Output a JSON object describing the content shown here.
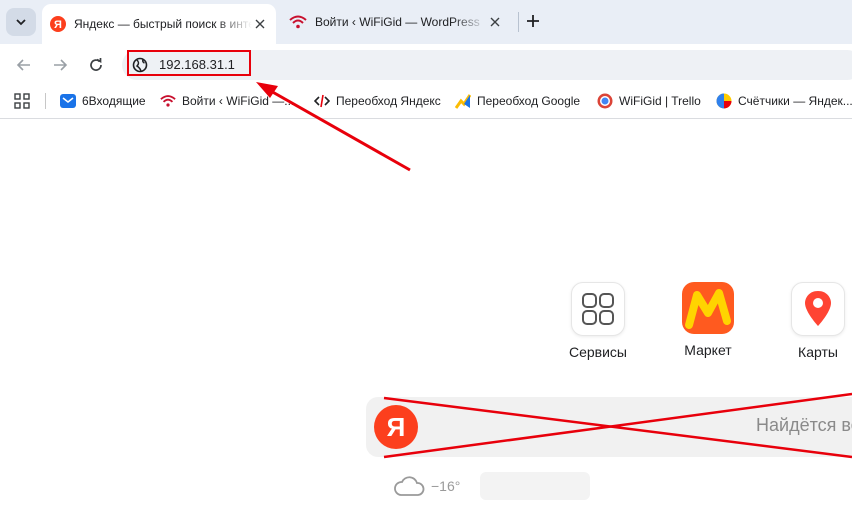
{
  "tabs": [
    {
      "title": "Яндекс — быстрый поиск в интернете",
      "active": true
    },
    {
      "title": "Войти ‹ WiFiGid — WordPress",
      "active": false
    }
  ],
  "address_bar": {
    "url": "192.168.31.1"
  },
  "bookmarks": [
    {
      "label": "6Входящие",
      "icon": "mail-icon"
    },
    {
      "label": "Войти ‹ WiFiGid —...",
      "icon": "wifi-icon"
    },
    {
      "label": "Переобход Яндекс",
      "icon": "code-icon"
    },
    {
      "label": "Переобход Google",
      "icon": "chart-icon"
    },
    {
      "label": "WiFiGid | Trello",
      "icon": "trello-icon"
    },
    {
      "label": "Счётчики — Яндек...",
      "icon": "metrika-icon"
    }
  ],
  "services": [
    {
      "label": "Сервисы",
      "icon": "grid-icon"
    },
    {
      "label": "Маркет",
      "icon": "market-icon"
    },
    {
      "label": "Карты",
      "icon": "map-pin-icon"
    }
  ],
  "search": {
    "logo": "Я",
    "placeholder": "Найдётся всё"
  },
  "weather": {
    "temperature": "−16°",
    "icon": "cloud-icon"
  },
  "colors": {
    "accent_red": "#e8000b",
    "yandex_red": "#fc3f1d",
    "tabstrip": "#e9eef6"
  }
}
